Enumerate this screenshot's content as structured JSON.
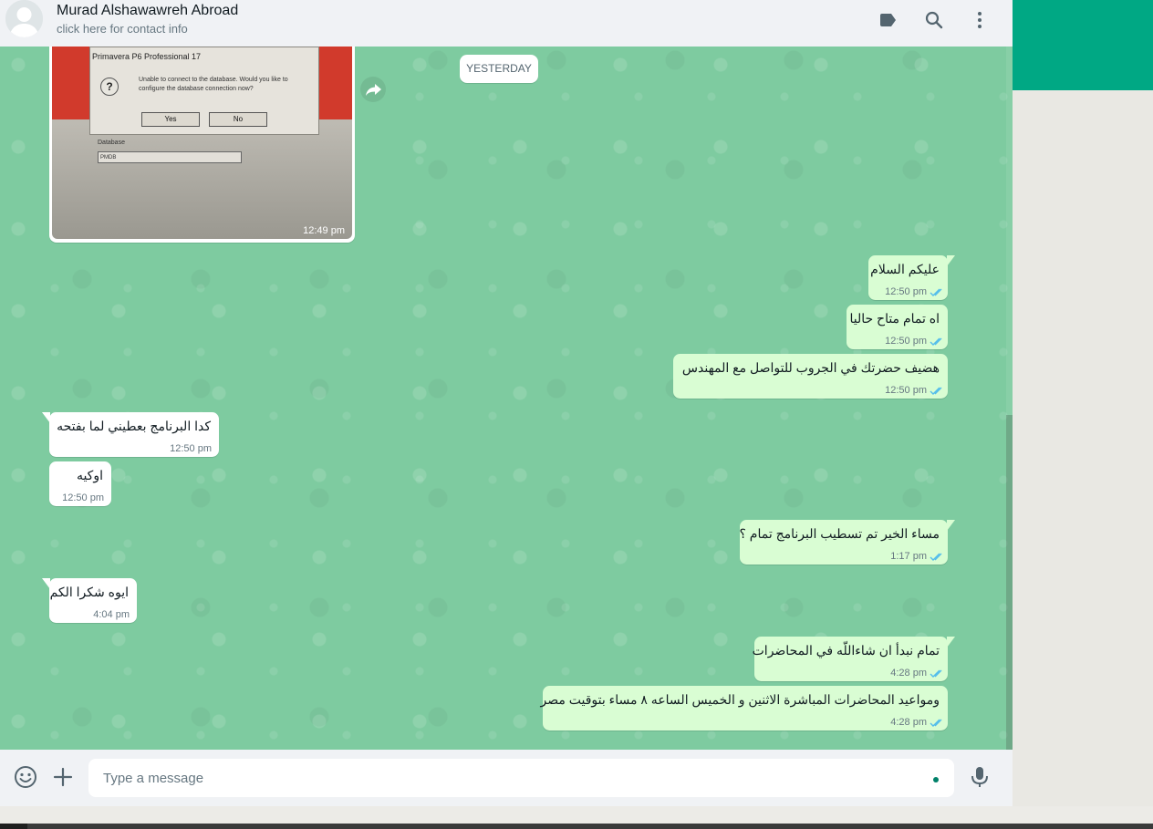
{
  "header": {
    "contact_name": "Murad Alshawawreh Abroad",
    "contact_subtitle": "click here for contact info",
    "icons": [
      "label-icon",
      "search-icon",
      "menu-icon"
    ]
  },
  "date_separator": "YESTERDAY",
  "image_message": {
    "time": "12:49 pm",
    "photo": {
      "dialog_title": "Primavera P6 Professional 17",
      "dialog_message": "Unable to connect to the database.  Would you like to configure the database connection now?",
      "yes_label": "Yes",
      "no_label": "No",
      "database_label": "Database",
      "database_value": "PMDB"
    }
  },
  "messages": [
    {
      "dir": "out",
      "text": "عليكم السلام",
      "time": "12:50 pm"
    },
    {
      "dir": "out",
      "text": "اه تمام متاح حاليا",
      "time": "12:50 pm"
    },
    {
      "dir": "out",
      "text": "هضيف حضرتك في الجروب للتواصل مع المهندس",
      "time": "12:50 pm"
    },
    {
      "dir": "in",
      "text": "كدا البرنامج بعطيني لما بفتحه",
      "time": "12:50 pm"
    },
    {
      "dir": "in",
      "text": "اوكيه",
      "time": "12:50 pm"
    },
    {
      "dir": "out",
      "text": "مساء الخير تم تسطيب البرنامج تمام ؟",
      "time": "1:17 pm"
    },
    {
      "dir": "in",
      "text": "ايوه شكرا الكم",
      "time": "4:04 pm"
    },
    {
      "dir": "out",
      "text": "تمام نبدأ ان شاءاللّه في المحاضرات",
      "time": "4:28 pm"
    },
    {
      "dir": "out",
      "text": "ومواعيد المحاضرات المباشرة الاثنين و الخميس الساعه ٨ مساء بتوقيت مصر",
      "time": "4:28 pm"
    }
  ],
  "composer": {
    "placeholder": "Type a message",
    "icons": [
      "emoji-icon",
      "attach-plus-icon",
      "microphone-icon"
    ]
  },
  "colors": {
    "accent": "#00a884",
    "chat_background": "#7ecba0",
    "outgoing_bubble": "#d9fdd3",
    "incoming_bubble": "#ffffff",
    "read_tick": "#53bdeb"
  }
}
